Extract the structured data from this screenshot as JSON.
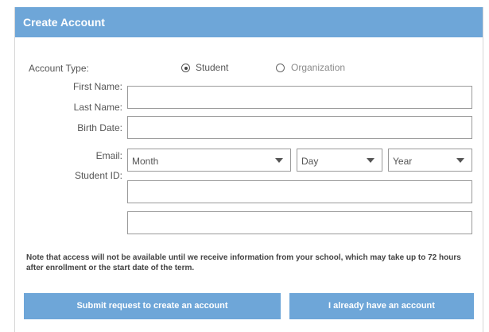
{
  "header": {
    "title": "Create Account",
    "background_color": "#6ea6d8"
  },
  "form": {
    "account_type": {
      "label": "Account Type:",
      "options": [
        {
          "label": "Student",
          "selected": true
        },
        {
          "label": "Organization",
          "selected": false
        }
      ]
    },
    "labels": {
      "first_name": "First Name:",
      "last_name": "Last Name:",
      "birth_date": "Birth Date:",
      "email": "Email:",
      "student_id": "Student ID:"
    },
    "fields": {
      "name_value": "",
      "last_name_value": "",
      "email_value": "",
      "student_id_value": ""
    },
    "birth_date": {
      "month": "Month",
      "day": "Day",
      "year": "Year"
    }
  },
  "note": "Note that access will not be available until we receive information from your school, which may take up to 72 hours after enrollment or the start date of the term.",
  "buttons": {
    "submit": "Submit request to create an account",
    "existing": "I already have an account"
  }
}
